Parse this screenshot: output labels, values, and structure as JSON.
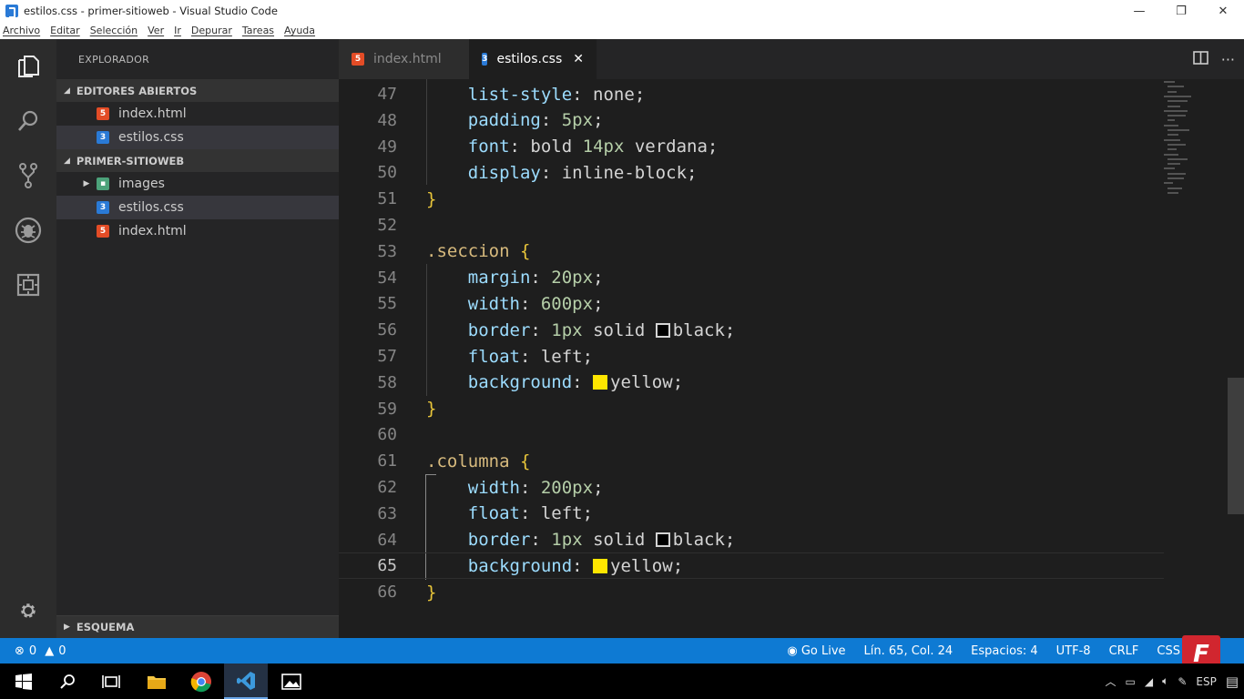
{
  "window": {
    "title": "estilos.css - primer-sitioweb - Visual Studio Code",
    "controls": [
      "—",
      "❐",
      "✕"
    ]
  },
  "menu": [
    "Archivo",
    "Editar",
    "Selección",
    "Ver",
    "Ir",
    "Depurar",
    "Tareas",
    "Ayuda"
  ],
  "activity_bar": {
    "items": [
      "explorer-icon",
      "search-icon",
      "source-control-icon",
      "debug-icon",
      "extensions-icon"
    ],
    "bottom": "gear-icon"
  },
  "sidebar": {
    "header": "EXPLORADOR",
    "open_editors": {
      "title": "EDITORES ABIERTOS",
      "files": [
        {
          "name": "index.html",
          "type": "html",
          "icon_label": "5"
        },
        {
          "name": "estilos.css",
          "type": "css",
          "icon_label": "3"
        }
      ]
    },
    "project": {
      "title": "PRIMER-SITIOWEB",
      "items": [
        {
          "name": "images",
          "type": "folder"
        },
        {
          "name": "estilos.css",
          "type": "css",
          "icon_label": "3"
        },
        {
          "name": "index.html",
          "type": "html",
          "icon_label": "5"
        }
      ]
    },
    "outline_title": "ESQUEMA"
  },
  "tabs": [
    {
      "label": "index.html",
      "type": "html",
      "icon_label": "5",
      "active": false
    },
    {
      "label": "estilos.css",
      "type": "css",
      "icon_label": "3",
      "active": true
    }
  ],
  "editor": {
    "current_line": 65,
    "lines": [
      {
        "n": 47,
        "text": "    list-style: none;"
      },
      {
        "n": 48,
        "text": "    padding: 5px;"
      },
      {
        "n": 49,
        "text": "    font: bold 14px verdana;"
      },
      {
        "n": 50,
        "text": "    display: inline-block;"
      },
      {
        "n": 51,
        "text": "}"
      },
      {
        "n": 52,
        "text": ""
      },
      {
        "n": 53,
        "text": ".seccion {"
      },
      {
        "n": 54,
        "text": "    margin: 20px;"
      },
      {
        "n": 55,
        "text": "    width: 600px;"
      },
      {
        "n": 56,
        "text": "    border: 1px solid black;"
      },
      {
        "n": 57,
        "text": "    float: left;"
      },
      {
        "n": 58,
        "text": "    background: yellow;"
      },
      {
        "n": 59,
        "text": "}"
      },
      {
        "n": 60,
        "text": ""
      },
      {
        "n": 61,
        "text": ".columna {"
      },
      {
        "n": 62,
        "text": "    width: 200px;"
      },
      {
        "n": 63,
        "text": "    float: left;"
      },
      {
        "n": 64,
        "text": "    border: 1px solid black;"
      },
      {
        "n": 65,
        "text": "    background: yellow;"
      },
      {
        "n": 66,
        "text": "}"
      }
    ]
  },
  "statusbar": {
    "errors": "0",
    "warnings": "0",
    "go_live": "Go Live",
    "position": "Lín. 65, Col. 24",
    "spaces": "Espacios: 4",
    "encoding": "UTF-8",
    "eol": "CRLF",
    "language": "CSS",
    "badge": "F"
  },
  "taskbar": {
    "apps": [
      "windows-start-icon",
      "search-icon",
      "task-view-icon",
      "file-explorer-icon",
      "chrome-icon",
      "vscode-icon",
      "photos-icon"
    ],
    "tray_lang": "ESP"
  },
  "colors": {
    "accent": "#0e7ad3",
    "editor_bg": "#1e1e1e",
    "sidebar_bg": "#252526",
    "html_icon": "#e34c26",
    "css_icon": "#2a7ad6",
    "selector": "#d7ba7d",
    "property": "#9cdcfe",
    "number": "#b5cea8"
  }
}
